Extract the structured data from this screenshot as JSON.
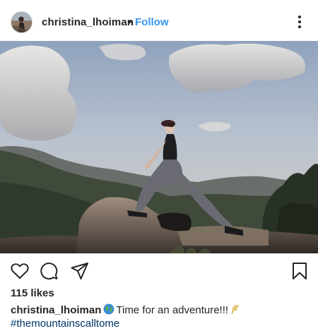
{
  "post": {
    "username": "christina_lhoiman",
    "separator": "•",
    "follow_label": "Follow",
    "likes_text": "115 likes",
    "caption": {
      "username": "christina_lhoiman",
      "text": "Time for an adventure!!!",
      "emojis": [
        "globe-emoji",
        "wheat-emoji"
      ]
    },
    "hashtag": "#themountainscalltome"
  },
  "icons": {
    "more": "vertical-ellipsis-icon",
    "like": "heart-icon",
    "comment": "comment-bubble-icon",
    "share": "paper-plane-icon",
    "save": "bookmark-icon"
  },
  "colors": {
    "link_blue": "#3897f0",
    "hashtag": "#003569",
    "text": "#262626"
  }
}
